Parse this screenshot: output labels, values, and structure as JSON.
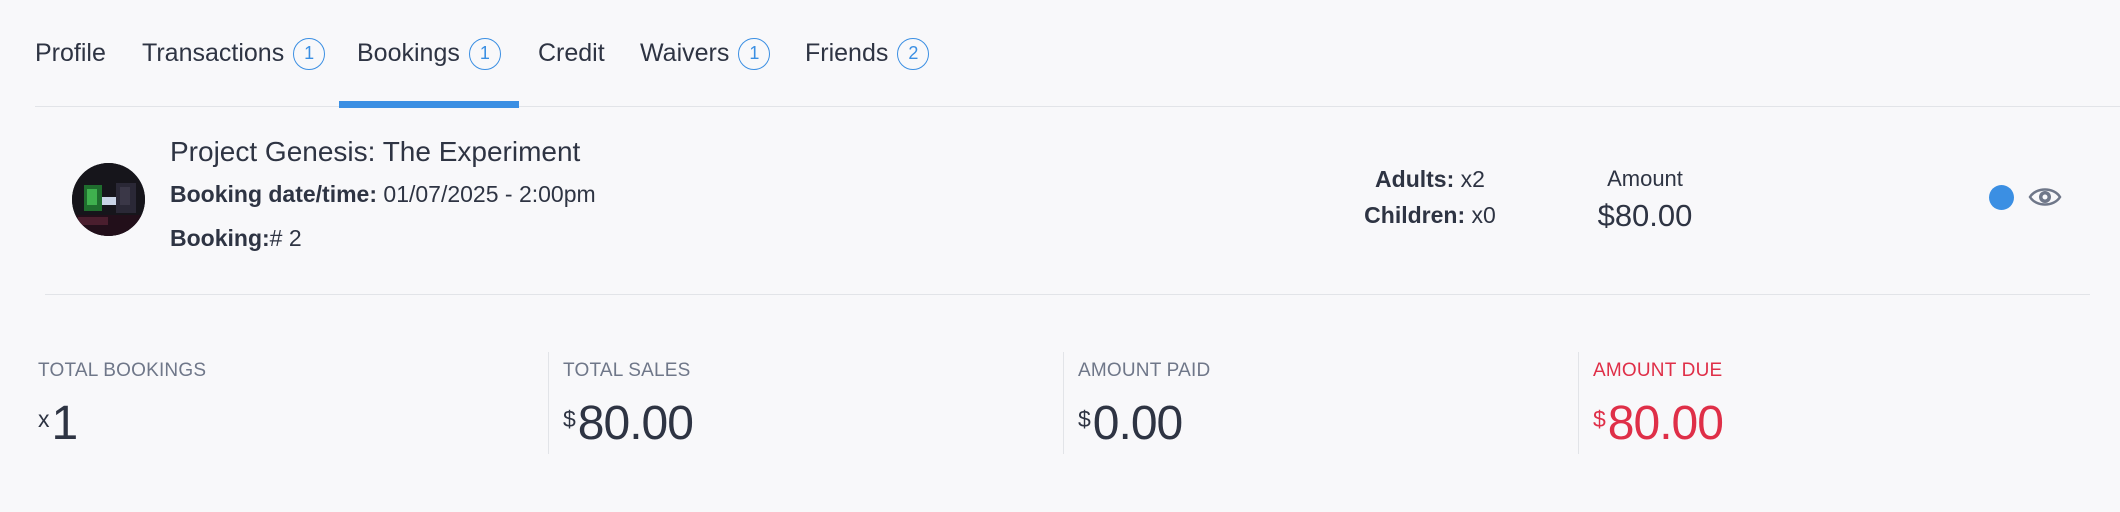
{
  "tabs": [
    {
      "label": "Profile"
    },
    {
      "label": "Transactions",
      "count": "1"
    },
    {
      "label": "Bookings",
      "count": "1",
      "active": true
    },
    {
      "label": "Credit"
    },
    {
      "label": "Waivers",
      "count": "1"
    },
    {
      "label": "Friends",
      "count": "2"
    }
  ],
  "booking": {
    "title": "Project Genesis: The Experiment",
    "date_label": "Booking date/time:",
    "date_value": " 01/07/2025 - 2:00pm",
    "number_label": "Booking:",
    "number_value": "# 2",
    "adults_label": "Adults:",
    "adults_value": " x2",
    "children_label": "Children:",
    "children_value": " x0",
    "amount_label": "Amount",
    "amount_value": "$80.00",
    "status_color": "#3b8fe3"
  },
  "stats": {
    "total_bookings_label": "TOTAL BOOKINGS",
    "total_bookings_prefix": "x",
    "total_bookings_value": "1",
    "total_sales_label": "TOTAL SALES",
    "total_sales_currency": "$",
    "total_sales_value": "80.00",
    "amount_paid_label": "AMOUNT PAID",
    "amount_paid_currency": "$",
    "amount_paid_value": "0.00",
    "amount_due_label": "AMOUNT DUE",
    "amount_due_currency": "$",
    "amount_due_value": "80.00",
    "due_color": "#df2f48"
  },
  "icons": [
    "status-dot-icon",
    "eye-icon",
    "booking-thumbnail"
  ]
}
